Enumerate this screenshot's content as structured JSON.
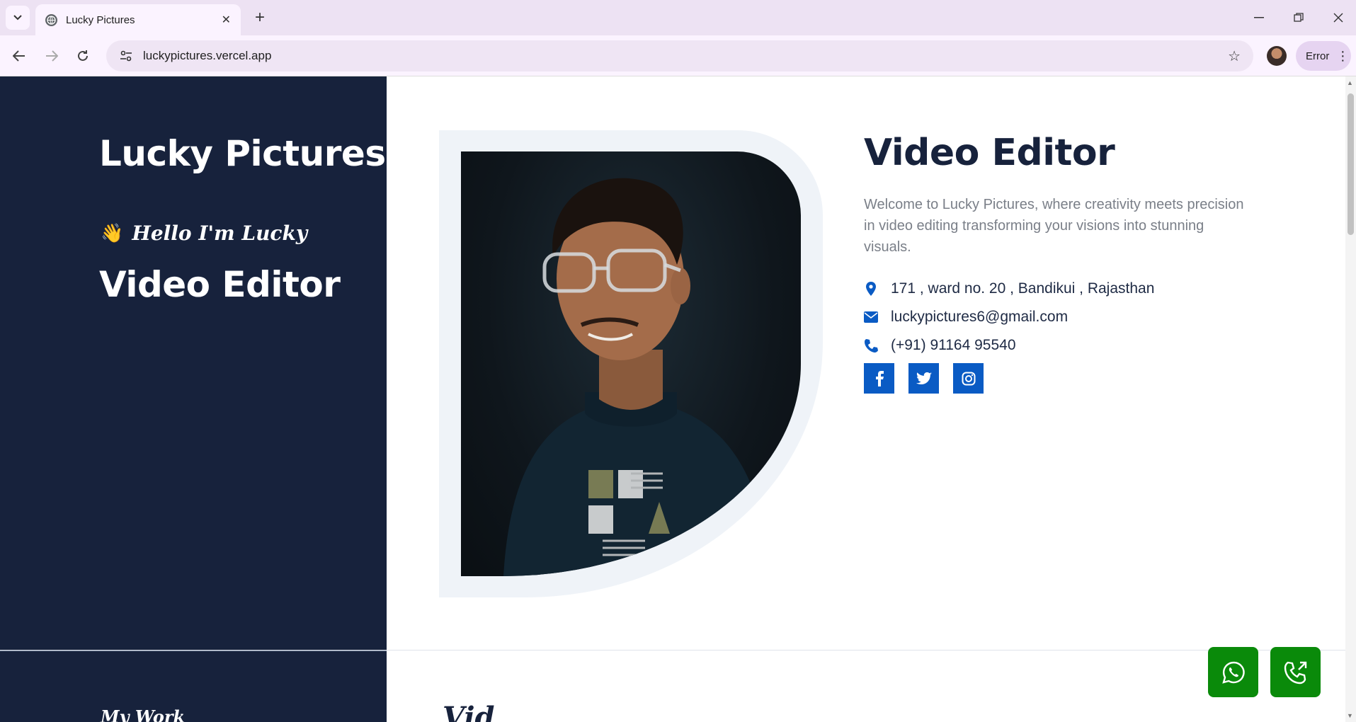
{
  "browser": {
    "tab_title": "Lucky Pictures",
    "url": "luckypictures.vercel.app",
    "profile_status": "Error"
  },
  "sidebar": {
    "brand": "Lucky Pictures",
    "greeting": "Hello I'm Lucky",
    "greeting_emoji": "👋",
    "role": "Video Editor",
    "next_section_label": "My Work"
  },
  "hero": {
    "title": "Video Editor",
    "description": "Welcome to Lucky Pictures, where creativity meets precision in video editing transforming your visions into stunning visuals.",
    "address": "171 , ward no. 20 , Bandikui , Rajasthan",
    "email": "luckypictures6@gmail.com",
    "phone": "(+91) 91164 95540",
    "socials": [
      "facebook-icon",
      "twitter-icon",
      "instagram-icon"
    ]
  },
  "next_section_heading_partial": "Vid",
  "colors": {
    "sidebar_bg": "#17223c",
    "accent_blue": "#0a5bc4",
    "fab_green": "#0a8a0a",
    "heading": "#17223c"
  }
}
